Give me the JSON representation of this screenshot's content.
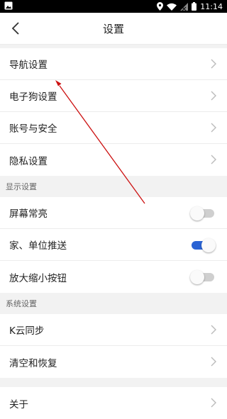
{
  "status_bar": {
    "time": "11:14"
  },
  "header": {
    "title": "设置"
  },
  "groups": {
    "account": {
      "items": [
        {
          "label": "导航设置"
        },
        {
          "label": "电子狗设置"
        },
        {
          "label": "账号与安全"
        },
        {
          "label": "隐私设置"
        }
      ]
    },
    "display": {
      "label": "显示设置",
      "items": [
        {
          "label": "屏幕常亮",
          "on": false
        },
        {
          "label": "家、单位推送",
          "on": true
        },
        {
          "label": "放大缩小按钮",
          "on": false
        }
      ]
    },
    "system": {
      "label": "系统设置",
      "items": [
        {
          "label": "K云同步"
        },
        {
          "label": "清空和恢复"
        }
      ]
    },
    "about": {
      "label": "关于"
    }
  },
  "colors": {
    "toggle_on": "#2a63d4",
    "annotation_arrow": "#cc1111"
  }
}
